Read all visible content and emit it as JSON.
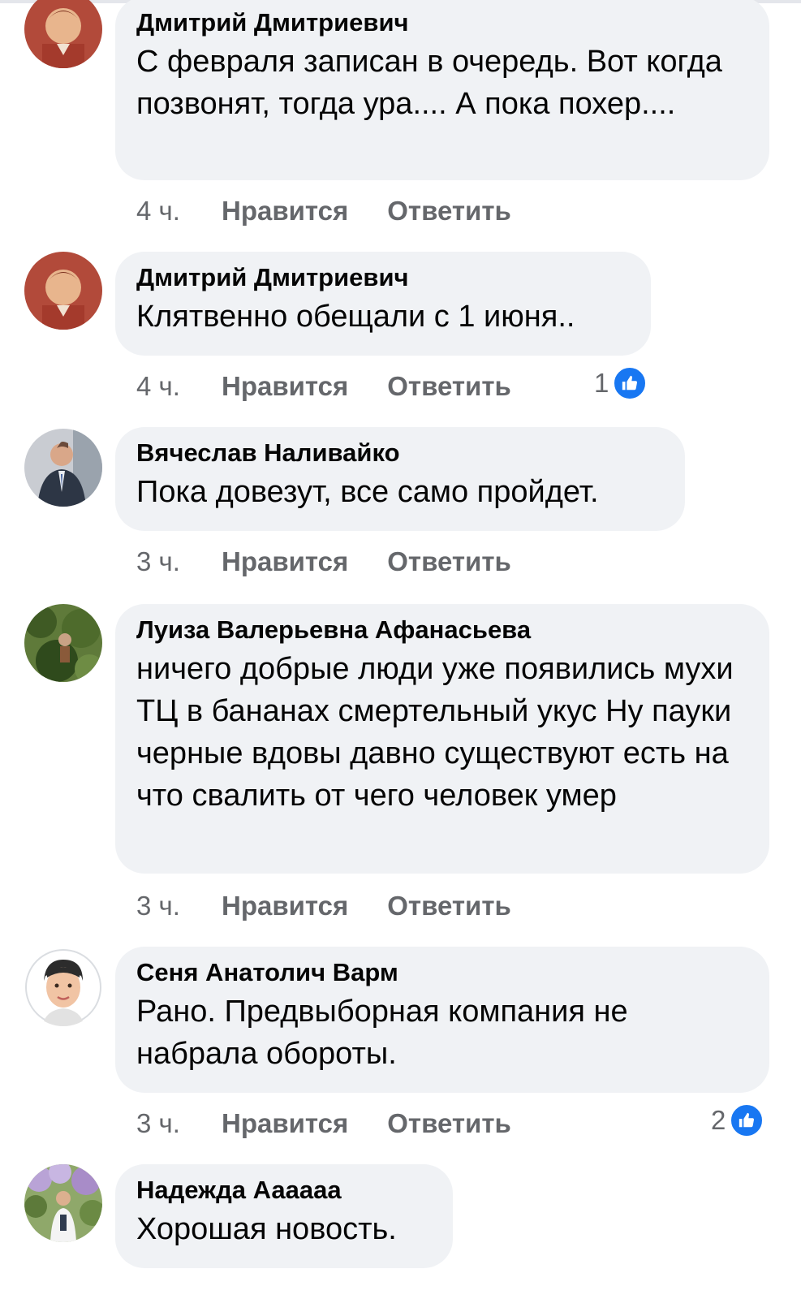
{
  "comments": [
    {
      "author": "Дмитрий Дмитриевич",
      "text": "С февраля записан в очередь. Вот когда позвонят, тогда ура.... А пока похер....",
      "time": "4 ч.",
      "like_label": "Нравится",
      "reply_label": "Ответить",
      "reactions": null,
      "avatar_icon": "user-photo-boy"
    },
    {
      "author": "Дмитрий Дмитриевич",
      "text": "Клятвенно обещали с 1 июня..",
      "time": "4 ч.",
      "like_label": "Нравится",
      "reply_label": "Ответить",
      "reactions": "1",
      "avatar_icon": "user-photo-boy"
    },
    {
      "author": "Вячеслав Наливайко",
      "text": "Пока довезут, все само пройдет.",
      "time": "3 ч.",
      "like_label": "Нравится",
      "reply_label": "Ответить",
      "reactions": null,
      "avatar_icon": "user-photo-man-suit"
    },
    {
      "author": "Луиза Валерьевна Афанасьева",
      "text": "ничего добрые люди уже появились мухи ТЦ в бананах смертельный укус Ну пауки черные вдовы давно существуют есть на что свалить от чего человек умер",
      "time": "3 ч.",
      "like_label": "Нравится",
      "reply_label": "Ответить",
      "reactions": null,
      "avatar_icon": "user-photo-greenery"
    },
    {
      "author": "Сеня Анатолич Варм",
      "text": "Рано. Предвыборная компания не набрала обороты.",
      "time": "3 ч.",
      "like_label": "Нравится",
      "reply_label": "Ответить",
      "reactions": "2",
      "avatar_icon": "user-cartoon-avatar"
    },
    {
      "author": "Надежда Аааааа",
      "text": "Хорошая новость.",
      "time": null,
      "like_label": null,
      "reply_label": null,
      "reactions": null,
      "avatar_icon": "user-photo-lilacs"
    }
  ],
  "colors": {
    "bubble": "#f0f2f5",
    "meta_text": "#65676b",
    "like_badge": "#1877f2"
  }
}
